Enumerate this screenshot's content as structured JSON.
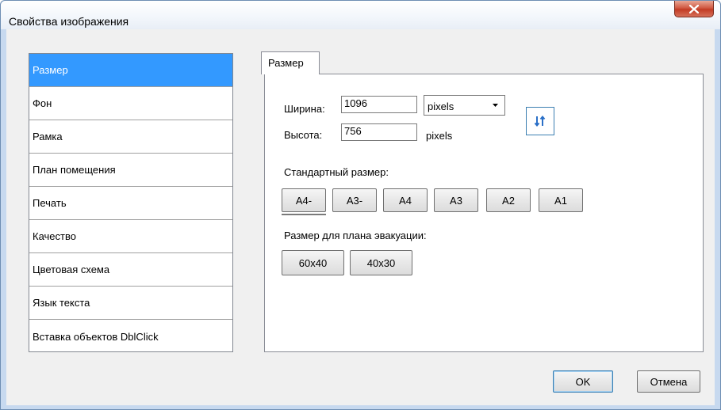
{
  "window": {
    "title": "Свойства изображения",
    "close_icon": "close-icon"
  },
  "sidebar": {
    "items": [
      {
        "label": "Размер",
        "selected": true
      },
      {
        "label": "Фон"
      },
      {
        "label": "Рамка"
      },
      {
        "label": "План помещения"
      },
      {
        "label": "Печать"
      },
      {
        "label": "Качество"
      },
      {
        "label": "Цветовая схема"
      },
      {
        "label": "Язык текста"
      },
      {
        "label": "Вставка объектов DblClick"
      }
    ]
  },
  "tab": {
    "label": "Размер"
  },
  "size": {
    "width_label": "Ширина:",
    "width_value": "1096",
    "height_label": "Высота:",
    "height_value": "756",
    "units_selected": "pixels",
    "height_units": "pixels",
    "swap_icon": "swap-dimensions-icon"
  },
  "standard": {
    "label": "Стандартный размер:",
    "buttons": [
      "A4-",
      "A3-",
      "A4",
      "A3",
      "A2",
      "A1"
    ]
  },
  "evac": {
    "label": "Размер для плана эвакуации:",
    "buttons": [
      "60x40",
      "40x30"
    ]
  },
  "footer": {
    "ok": "OK",
    "cancel": "Отмена"
  },
  "colors": {
    "selection": "#3399ff",
    "swap_arrow": "#2a6fc7"
  }
}
